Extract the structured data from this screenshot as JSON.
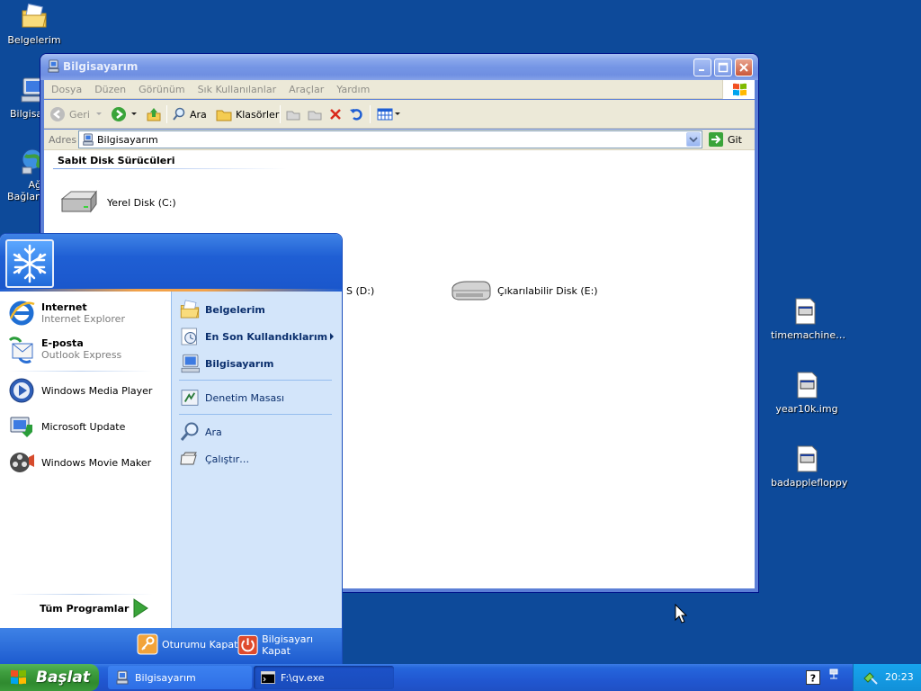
{
  "desktop": {
    "icons_left": [
      {
        "label": "Belgelerim",
        "icon": "my-documents-icon"
      },
      {
        "label": "Bilgisay",
        "icon": "my-computer-icon"
      },
      {
        "label": "Ağ",
        "icon": "network-icon"
      },
      {
        "label": "Bağlant",
        "icon": "network-icon"
      }
    ],
    "icons_right": [
      {
        "label": "timemachine…",
        "icon": "file-icon"
      },
      {
        "label": "year10k.img",
        "icon": "file-icon"
      },
      {
        "label": "badapplefloppy",
        "icon": "file-icon"
      }
    ]
  },
  "explorer": {
    "title": "Bilgisayarım",
    "menu": [
      "Dosya",
      "Düzen",
      "Görünüm",
      "Sık Kullanılanlar",
      "Araçlar",
      "Yardım"
    ],
    "toolbar": {
      "back": "Geri",
      "search": "Ara",
      "folders": "Klasörler"
    },
    "address": {
      "label": "Adres",
      "value": "Bilgisayarım",
      "go": "Git"
    },
    "group_header": "Sabit Disk Sürücüleri",
    "drives": [
      {
        "label": "Yerel Disk (C:)"
      },
      {
        "label": "S (D:)"
      },
      {
        "label": "Çıkarılabilir Disk (E:)"
      }
    ]
  },
  "start_menu": {
    "left_pinned": [
      {
        "title": "Internet",
        "subtitle": "Internet Explorer"
      },
      {
        "title": "E-posta",
        "subtitle": "Outlook Express"
      }
    ],
    "left_recent": [
      {
        "title": "Windows Media Player"
      },
      {
        "title": "Microsoft Update"
      },
      {
        "title": "Windows Movie Maker"
      }
    ],
    "all_programs": "Tüm Programlar",
    "right_items": [
      {
        "title": "Belgelerim"
      },
      {
        "title": "En Son Kullandıklarım"
      },
      {
        "title": "Bilgisayarım"
      },
      {
        "title": "Denetim Masası"
      },
      {
        "title": "Ara"
      },
      {
        "title": "Çalıştır…"
      }
    ],
    "logoff": "Oturumu Kapat",
    "shutdown": "Bilgisayarı Kapat"
  },
  "taskbar": {
    "start": "Başlat",
    "tasks": [
      {
        "label": "Bilgisayarım"
      },
      {
        "label": "F:\\qv.exe"
      }
    ],
    "clock": "20:23"
  },
  "colors": {
    "desktop": "#0d4a9a",
    "taskbar": "#2157d1",
    "start_button": "#3f9f3f",
    "tray": "#1290d8"
  }
}
